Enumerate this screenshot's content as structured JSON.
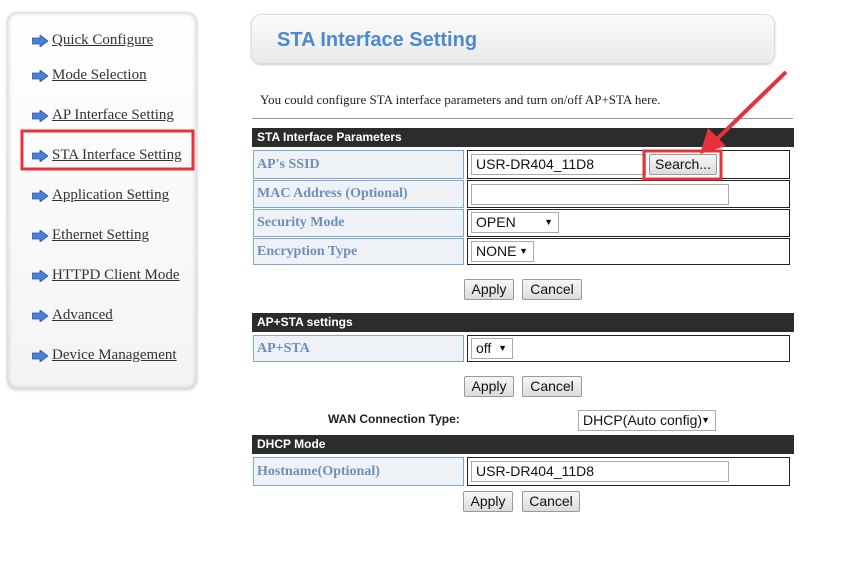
{
  "sidebar": {
    "items": [
      {
        "label": "Quick Configure"
      },
      {
        "label": "Mode Selection"
      },
      {
        "label": "AP Interface Setting"
      },
      {
        "label": "STA Interface Setting",
        "highlighted": true
      },
      {
        "label": "Application Setting"
      },
      {
        "label": "Ethernet Setting"
      },
      {
        "label": "HTTPD Client Mode"
      },
      {
        "label": "Advanced"
      },
      {
        "label": "Device Management"
      }
    ],
    "icon": "arrow-right-icon"
  },
  "header": {
    "title": "STA Interface Setting"
  },
  "description": "You could configure STA interface parameters and turn on/off AP+STA here.",
  "sta": {
    "title": "STA Interface Parameters",
    "ssid_label": "AP's SSID",
    "ssid_value": "USR-DR404_11D8",
    "search_label": "Search...",
    "mac_label": "MAC Address (Optional)",
    "mac_value": "",
    "security_label": "Security Mode",
    "security_value": "OPEN",
    "encryption_label": "Encryption Type",
    "encryption_value": "NONE",
    "apply": "Apply",
    "cancel": "Cancel"
  },
  "apsta": {
    "title": "AP+STA settings",
    "label": "AP+STA",
    "value": "off",
    "apply": "Apply",
    "cancel": "Cancel"
  },
  "wan": {
    "label": "WAN Connection Type:",
    "value": "DHCP(Auto config)"
  },
  "dhcp": {
    "title": "DHCP Mode",
    "hostname_label": "Hostname(Optional)",
    "hostname_value": "USR-DR404_11D8",
    "apply": "Apply",
    "cancel": "Cancel"
  },
  "colors": {
    "accent": "#4a8ad0",
    "annotation": "#e8313a",
    "section_bar": "#2c2c2c"
  }
}
